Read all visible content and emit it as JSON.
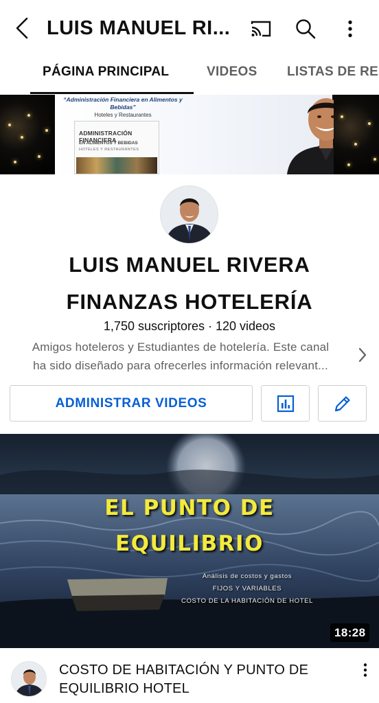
{
  "header": {
    "title": "LUIS MANUEL RI...",
    "icons": [
      "back-arrow-icon",
      "cast-icon",
      "search-icon",
      "more-vert-icon"
    ]
  },
  "tabs": [
    {
      "label": "PÁGINA PRINCIPAL",
      "active": true
    },
    {
      "label": "VIDEOS",
      "active": false
    },
    {
      "label": "LISTAS DE REPRODUCCIÓN",
      "active": false
    }
  ],
  "banner": {
    "heading": "“Administración Financiera en Alimentos y Bebidas”",
    "subheading": "Hoteles y Restaurantes",
    "book_title": "ADMINISTRACIÓN FINANCIERA",
    "book_subtitle": "EN ALIMENTOS Y BEBIDAS",
    "book_tagline": "HOTELES Y RESTAURANTES"
  },
  "channel": {
    "name_line1": "LUIS MANUEL RIVERA",
    "name_line2": "FINANZAS HOTELERÍA",
    "meta": "1,750 suscriptores · 120 videos",
    "description_line1": "Amigos hoteleros y Estudiantes de hotelería. Este canal",
    "description_line2": "ha sido diseñado para ofrecerles información relevant..."
  },
  "actions": {
    "manage_label": "ADMINISTRAR VIDEOS",
    "stats_icon": "analytics-icon",
    "edit_icon": "edit-pencil-icon"
  },
  "video": {
    "thumb_title_line1": "EL PUNTO DE",
    "thumb_title_line2": "EQUILIBRIO",
    "thumb_sub1": "Análisis de costos y gastos",
    "thumb_sub2": "FIJOS Y VARIABLES",
    "thumb_sub3": "COSTO DE LA HABITACIÓN DE HOTEL",
    "duration": "18:28",
    "title": "COSTO DE HABITACIÓN Y PUNTO DE EQUILIBRIO HOTEL"
  },
  "colors": {
    "accent_blue": "#065fd4",
    "thumb_title_yellow": "#f3ea3b",
    "text_primary": "#0f0f0f",
    "text_secondary": "#606060"
  }
}
